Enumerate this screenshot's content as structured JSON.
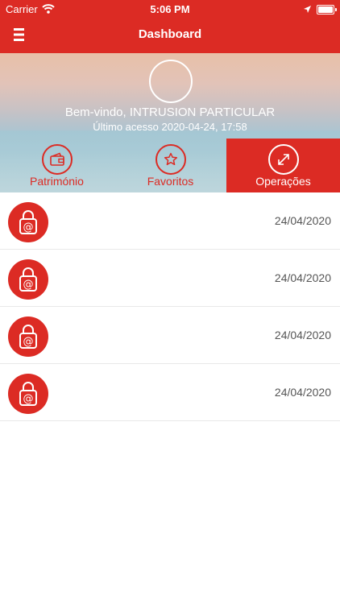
{
  "status_bar": {
    "carrier": "Carrier",
    "time": "5:06 PM"
  },
  "header": {
    "title": "Dashboard",
    "menu_icon": "hamburger-menu-icon"
  },
  "profile": {
    "welcome": "Bem-vindo, INTRUSION PARTICULAR",
    "last_access": "Último acesso 2020-04-24, 17:58"
  },
  "tabs": [
    {
      "label": "Património",
      "icon": "wallet-icon",
      "active": false
    },
    {
      "label": "Favoritos",
      "icon": "star-icon",
      "active": false
    },
    {
      "label": "Operações",
      "icon": "expand-arrows-icon",
      "active": true
    }
  ],
  "operations": [
    {
      "icon": "secure-lock-icon",
      "date": "24/04/2020"
    },
    {
      "icon": "secure-lock-icon",
      "date": "24/04/2020"
    },
    {
      "icon": "secure-lock-icon",
      "date": "24/04/2020"
    },
    {
      "icon": "secure-lock-icon",
      "date": "24/04/2020"
    }
  ],
  "colors": {
    "brand_red": "#dc2b24",
    "text_gray": "#555555"
  }
}
